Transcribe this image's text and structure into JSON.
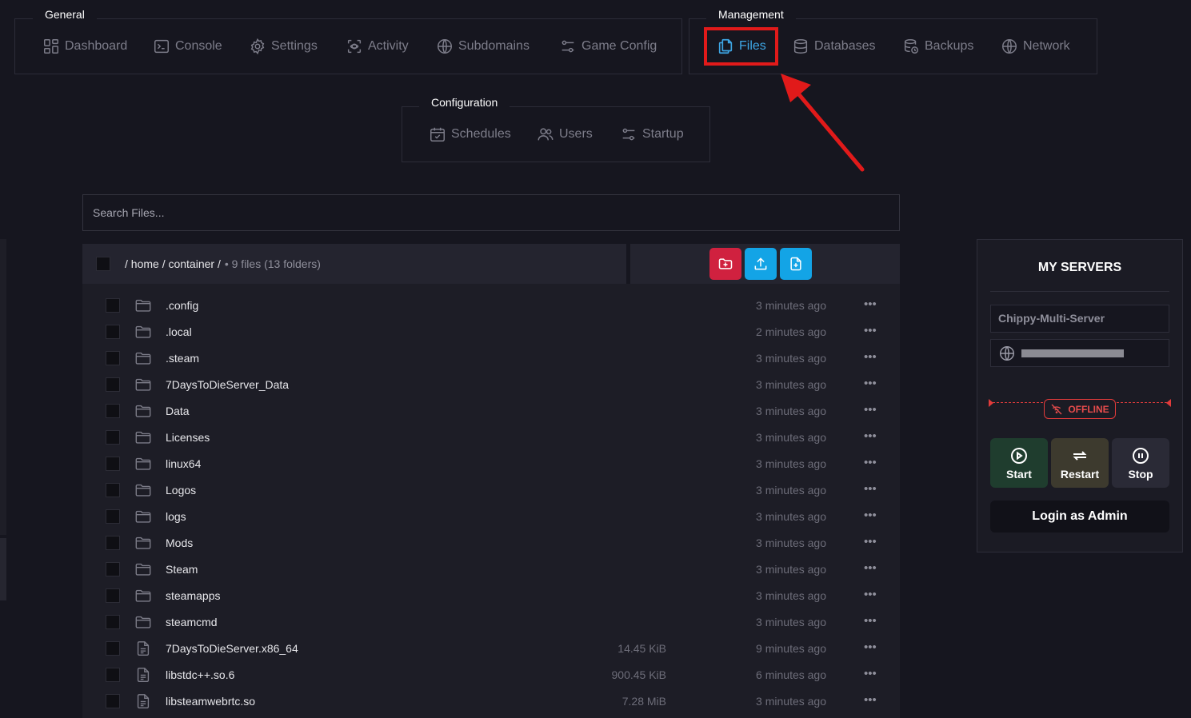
{
  "nav": {
    "general": {
      "legend": "General",
      "items": [
        {
          "label": "Dashboard",
          "icon": "dashboard-icon"
        },
        {
          "label": "Console",
          "icon": "console-icon"
        },
        {
          "label": "Settings",
          "icon": "gear-icon"
        },
        {
          "label": "Activity",
          "icon": "activity-icon"
        },
        {
          "label": "Subdomains",
          "icon": "globe-icon"
        },
        {
          "label": "Game Config",
          "icon": "sliders-icon"
        }
      ]
    },
    "management": {
      "legend": "Management",
      "items": [
        {
          "label": "Files",
          "icon": "files-icon",
          "active": true
        },
        {
          "label": "Databases",
          "icon": "database-icon"
        },
        {
          "label": "Backups",
          "icon": "backup-icon"
        },
        {
          "label": "Network",
          "icon": "globe-icon"
        }
      ]
    },
    "configuration": {
      "legend": "Configuration",
      "items": [
        {
          "label": "Schedules",
          "icon": "calendar-icon"
        },
        {
          "label": "Users",
          "icon": "users-icon"
        },
        {
          "label": "Startup",
          "icon": "sliders-icon"
        }
      ]
    }
  },
  "search": {
    "placeholder": "Search Files..."
  },
  "breadcrumb": {
    "path": "/ home / container /",
    "count": "• 9 files (13 folders)"
  },
  "actions": {
    "create_folder_color": "#d0213f",
    "upload_color": "#13a4e6",
    "new_file_color": "#13a4e6"
  },
  "files": [
    {
      "name": ".config",
      "type": "folder",
      "size": "",
      "modified": "3 minutes ago"
    },
    {
      "name": ".local",
      "type": "folder",
      "size": "",
      "modified": "2 minutes ago"
    },
    {
      "name": ".steam",
      "type": "folder",
      "size": "",
      "modified": "3 minutes ago"
    },
    {
      "name": "7DaysToDieServer_Data",
      "type": "folder",
      "size": "",
      "modified": "3 minutes ago"
    },
    {
      "name": "Data",
      "type": "folder",
      "size": "",
      "modified": "3 minutes ago"
    },
    {
      "name": "Licenses",
      "type": "folder",
      "size": "",
      "modified": "3 minutes ago"
    },
    {
      "name": "linux64",
      "type": "folder",
      "size": "",
      "modified": "3 minutes ago"
    },
    {
      "name": "Logos",
      "type": "folder",
      "size": "",
      "modified": "3 minutes ago"
    },
    {
      "name": "logs",
      "type": "folder",
      "size": "",
      "modified": "3 minutes ago"
    },
    {
      "name": "Mods",
      "type": "folder",
      "size": "",
      "modified": "3 minutes ago"
    },
    {
      "name": "Steam",
      "type": "folder",
      "size": "",
      "modified": "3 minutes ago"
    },
    {
      "name": "steamapps",
      "type": "folder",
      "size": "",
      "modified": "3 minutes ago"
    },
    {
      "name": "steamcmd",
      "type": "folder",
      "size": "",
      "modified": "3 minutes ago"
    },
    {
      "name": "7DaysToDieServer.x86_64",
      "type": "file",
      "size": "14.45 KiB",
      "modified": "9 minutes ago"
    },
    {
      "name": "libstdc++.so.6",
      "type": "file",
      "size": "900.45 KiB",
      "modified": "6 minutes ago"
    },
    {
      "name": "libsteamwebrtc.so",
      "type": "file",
      "size": "7.28 MiB",
      "modified": "3 minutes ago"
    }
  ],
  "servers_panel": {
    "title": "MY SERVERS",
    "server_name": "Chippy-Multi-Server",
    "status": "OFFLINE",
    "status_color": "#e13b3b",
    "buttons": {
      "start": "Start",
      "restart": "Restart",
      "stop": "Stop"
    },
    "button_colors": {
      "start": "#1f3d2e",
      "restart": "#3d3a2e",
      "stop": "#2a2a36"
    },
    "login": "Login as Admin"
  },
  "annotation": {
    "highlight_color": "#e11a1a"
  }
}
